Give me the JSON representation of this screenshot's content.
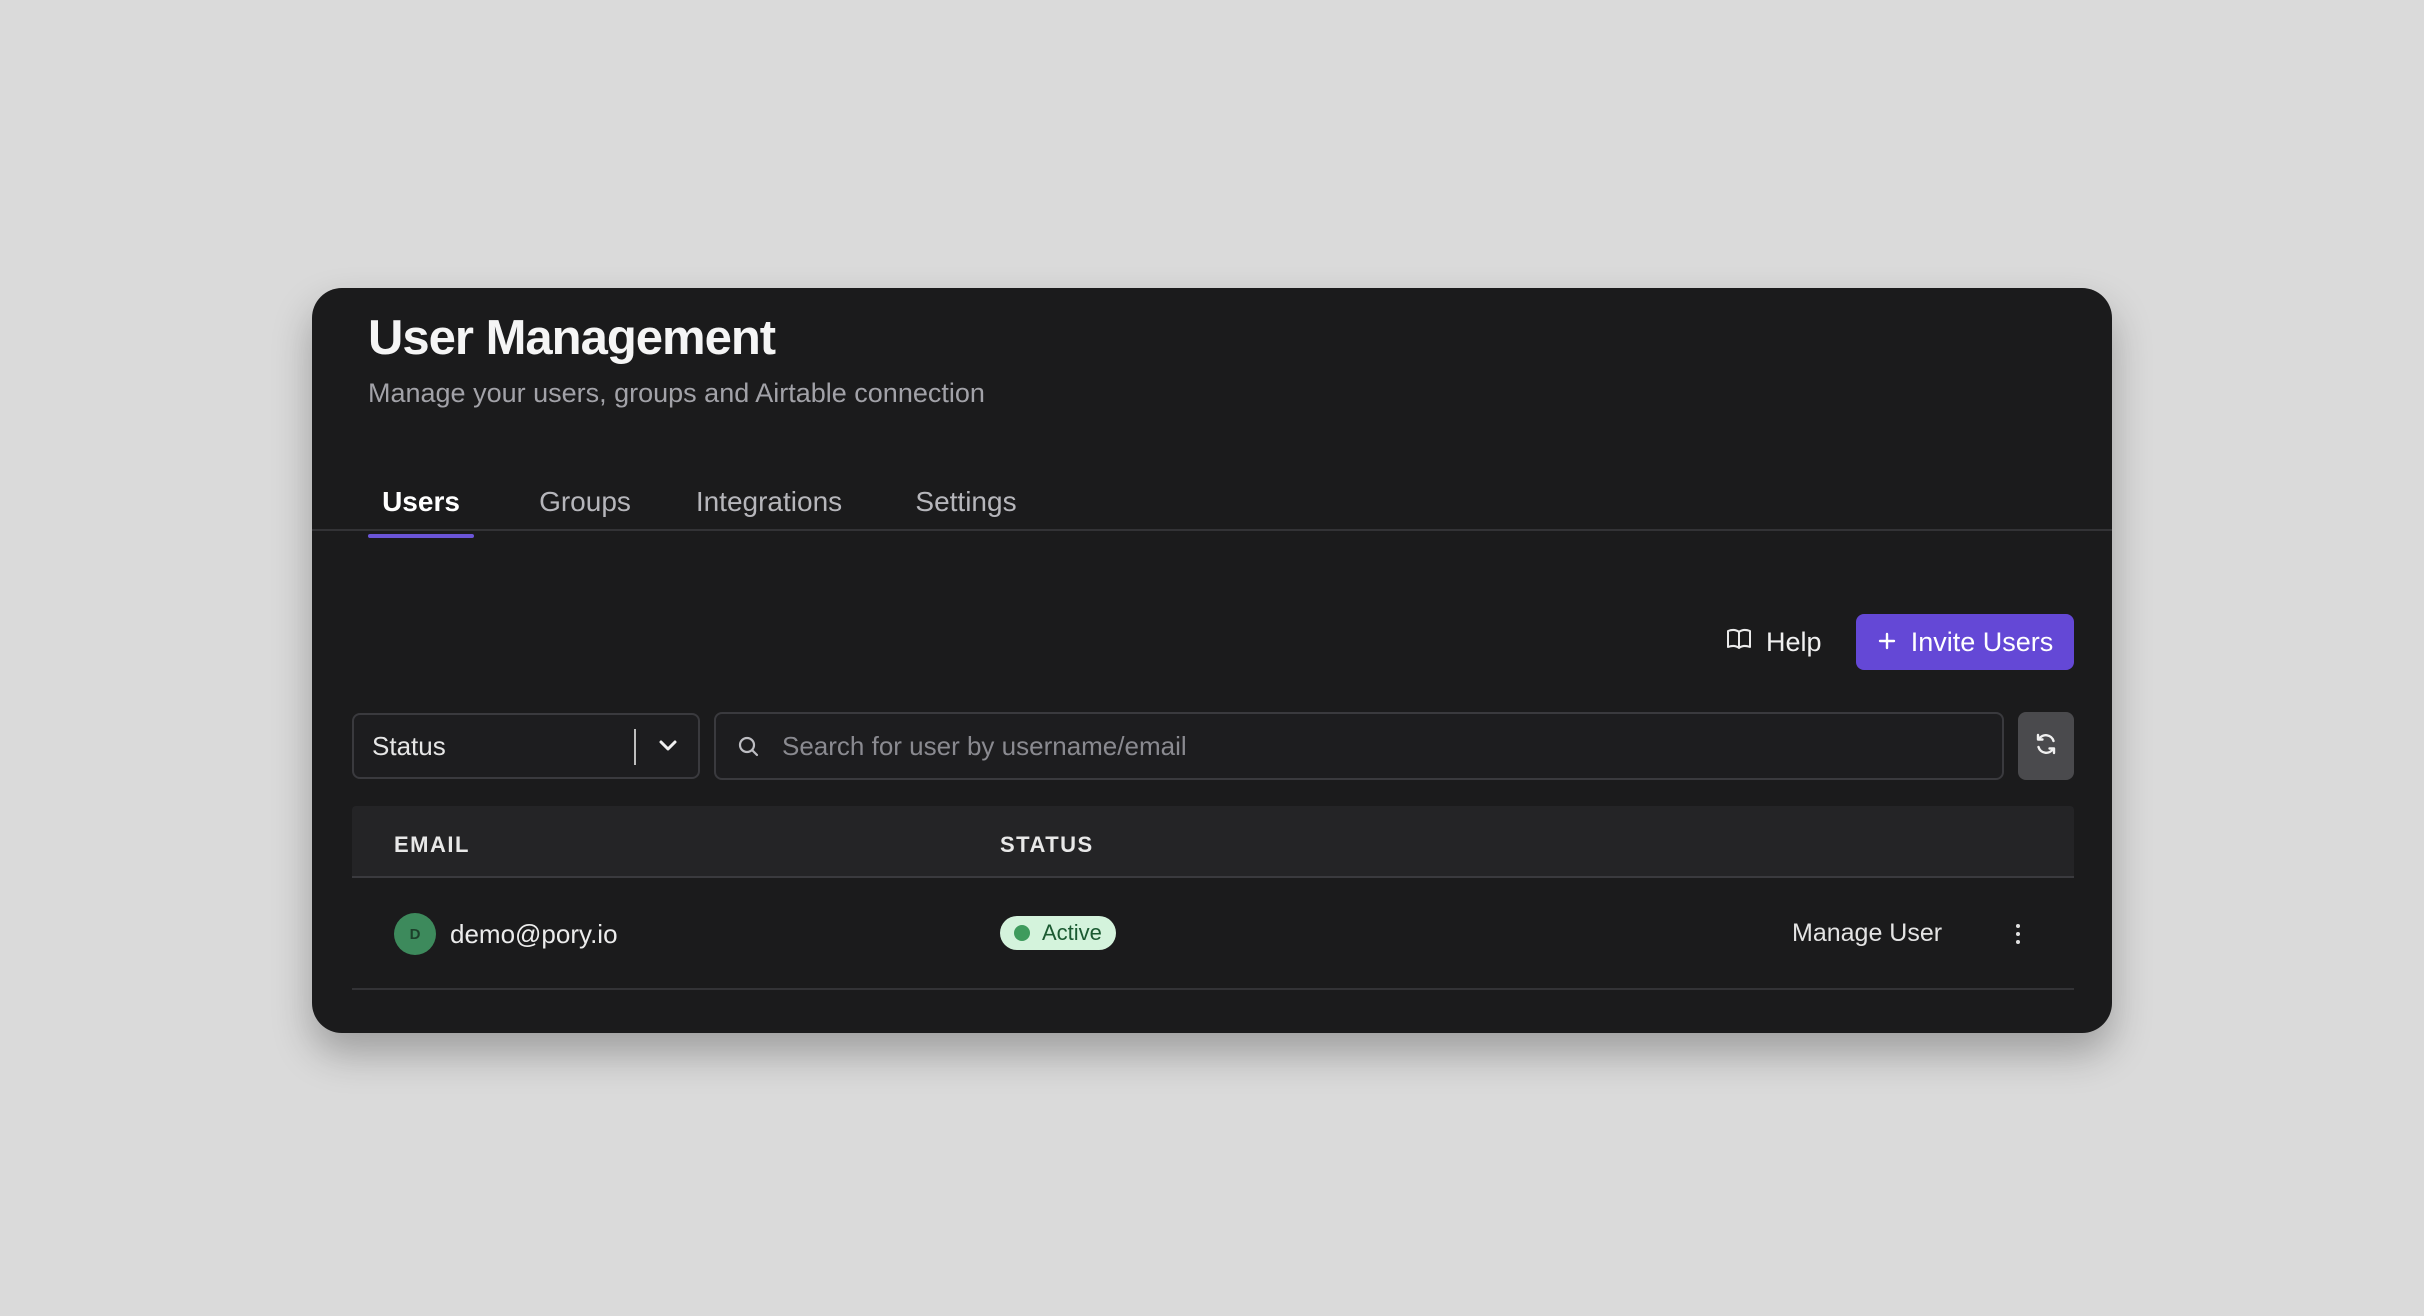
{
  "header": {
    "title": "User Management",
    "subtitle": "Manage your users, groups and Airtable connection"
  },
  "tabs": [
    {
      "label": "Users",
      "active": true
    },
    {
      "label": "Groups",
      "active": false
    },
    {
      "label": "Integrations",
      "active": false
    },
    {
      "label": "Settings",
      "active": false
    }
  ],
  "toolbar": {
    "help_label": "Help",
    "help_icon": "book-open-icon",
    "invite_label": "Invite Users",
    "invite_icon": "plus-icon"
  },
  "filters": {
    "status_label": "Status",
    "search_placeholder": "Search for user by username/email",
    "search_value": "",
    "refresh_icon": "refresh-icon"
  },
  "table": {
    "columns": [
      "EMAIL",
      "STATUS"
    ],
    "rows": [
      {
        "avatar_initial": "D",
        "email": "demo@pory.io",
        "status": "Active",
        "action": "Manage User"
      }
    ]
  },
  "colors": {
    "accent": "#6448d6",
    "card_bg": "#1b1b1c",
    "status_active_bg": "#d4f3dc",
    "status_active_dot": "#3e9b5d",
    "avatar_bg": "#3d8a5c"
  }
}
